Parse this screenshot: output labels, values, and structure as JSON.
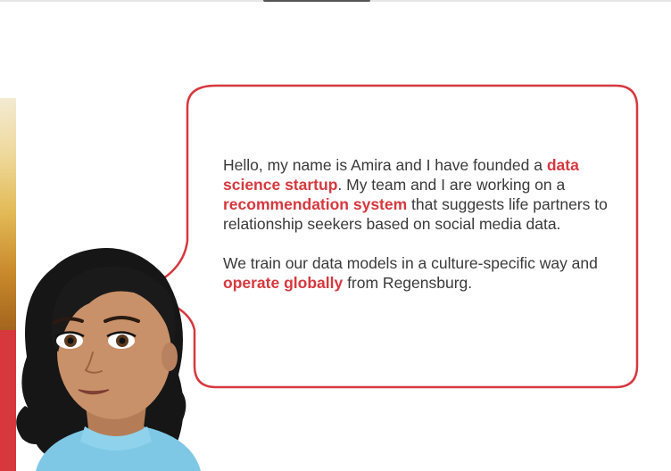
{
  "speech": {
    "p1_a": "Hello, my name is Amira and I have founded a ",
    "p1_hl1": "data science startup",
    "p1_b": ". My team and I are working on a ",
    "p1_hl2": "recommendation system",
    "p1_c": " that suggests life partners to relationship seekers based on social media data.",
    "p2_a": "We train our data models in a culture-specific way and ",
    "p2_hl": "operate globally",
    "p2_b": " from Regensburg."
  },
  "colors": {
    "accent": "#d6383e",
    "text": "#3a3a3a",
    "skin": "#c9916a",
    "hair": "#1a1a1a",
    "shirt": "#7ec8e6"
  },
  "icons": {
    "avatar": "woman-avatar-icon"
  }
}
